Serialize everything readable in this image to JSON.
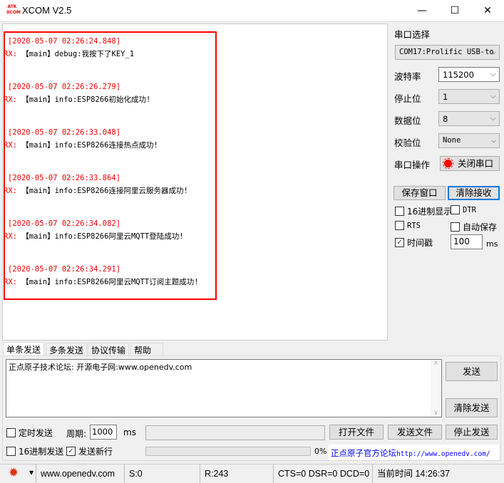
{
  "window": {
    "title": "XCOM V2.5",
    "logo_text": "ATK XCOM",
    "minimize": "—",
    "maximize": "☐",
    "close": "✕"
  },
  "log": [
    {
      "time": "[2020-05-07 02:26:24.848]",
      "prefix": "RX:",
      "msg": "【main】debug:我按下了KEY_1"
    },
    {
      "time": "[2020-05-07 02:26:26.279]",
      "prefix": "RX:",
      "msg": "【main】info:ESP8266初始化成功!"
    },
    {
      "time": "[2020-05-07 02:26:33.048]",
      "prefix": "RX:",
      "msg": "【main】info:ESP8266连接热点成功!"
    },
    {
      "time": "[2020-05-07 02:26:33.864]",
      "prefix": "RX:",
      "msg": "【main】info:ESP8266连接阿里云服务器成功!"
    },
    {
      "time": "[2020-05-07 02:26:34.082]",
      "prefix": "RX:",
      "msg": "【main】info:ESP8266阿里云MQTT登陆成功!"
    },
    {
      "time": "[2020-05-07 02:26:34.291]",
      "prefix": "RX:",
      "msg": "【main】info:ESP8266阿里云MQTT订阅主题成功!"
    }
  ],
  "panel": {
    "port_label": "串口选择",
    "port_value": "COM17:Prolific USB-to",
    "baud_label": "波特率",
    "baud_value": "115200",
    "stop_label": "停止位",
    "stop_value": "1",
    "data_label": "数据位",
    "data_value": "8",
    "parity_label": "校验位",
    "parity_value": "None",
    "op_label": "串口操作",
    "op_button": "关闭串口",
    "save_button": "保存窗口",
    "clear_button": "清除接收",
    "hex_display": "16进制显示",
    "dtr": "DTR",
    "rts": "RTS",
    "autosave": "自动保存",
    "timestamp": "时间戳",
    "timestamp_value": "100",
    "ms": "ms"
  },
  "tabs": [
    "单条发送",
    "多条发送",
    "协议传输",
    "帮助"
  ],
  "send": {
    "text": "正点原子技术论坛: 开源电子网:www.openedv.com",
    "send_button": "发送",
    "clear_button": "清除发送",
    "timed_send": "定时发送",
    "period_label": "周期:",
    "period_value": "1000",
    "ms": "ms",
    "open_file": "打开文件",
    "send_file": "发送文件",
    "stop_send": "停止发送",
    "hex_send": "16进制发送",
    "newline": "发送新行",
    "progress": "0%",
    "progress_value": 0,
    "link_cn": "正点原子官方论坛",
    "link_url": "http://www.openedv.com/"
  },
  "status": {
    "website": "www.openedv.com",
    "sent": "S:0",
    "received": "R:243",
    "lines": "CTS=0 DSR=0 DCD=0",
    "time": "当前时间 14:26:37"
  }
}
